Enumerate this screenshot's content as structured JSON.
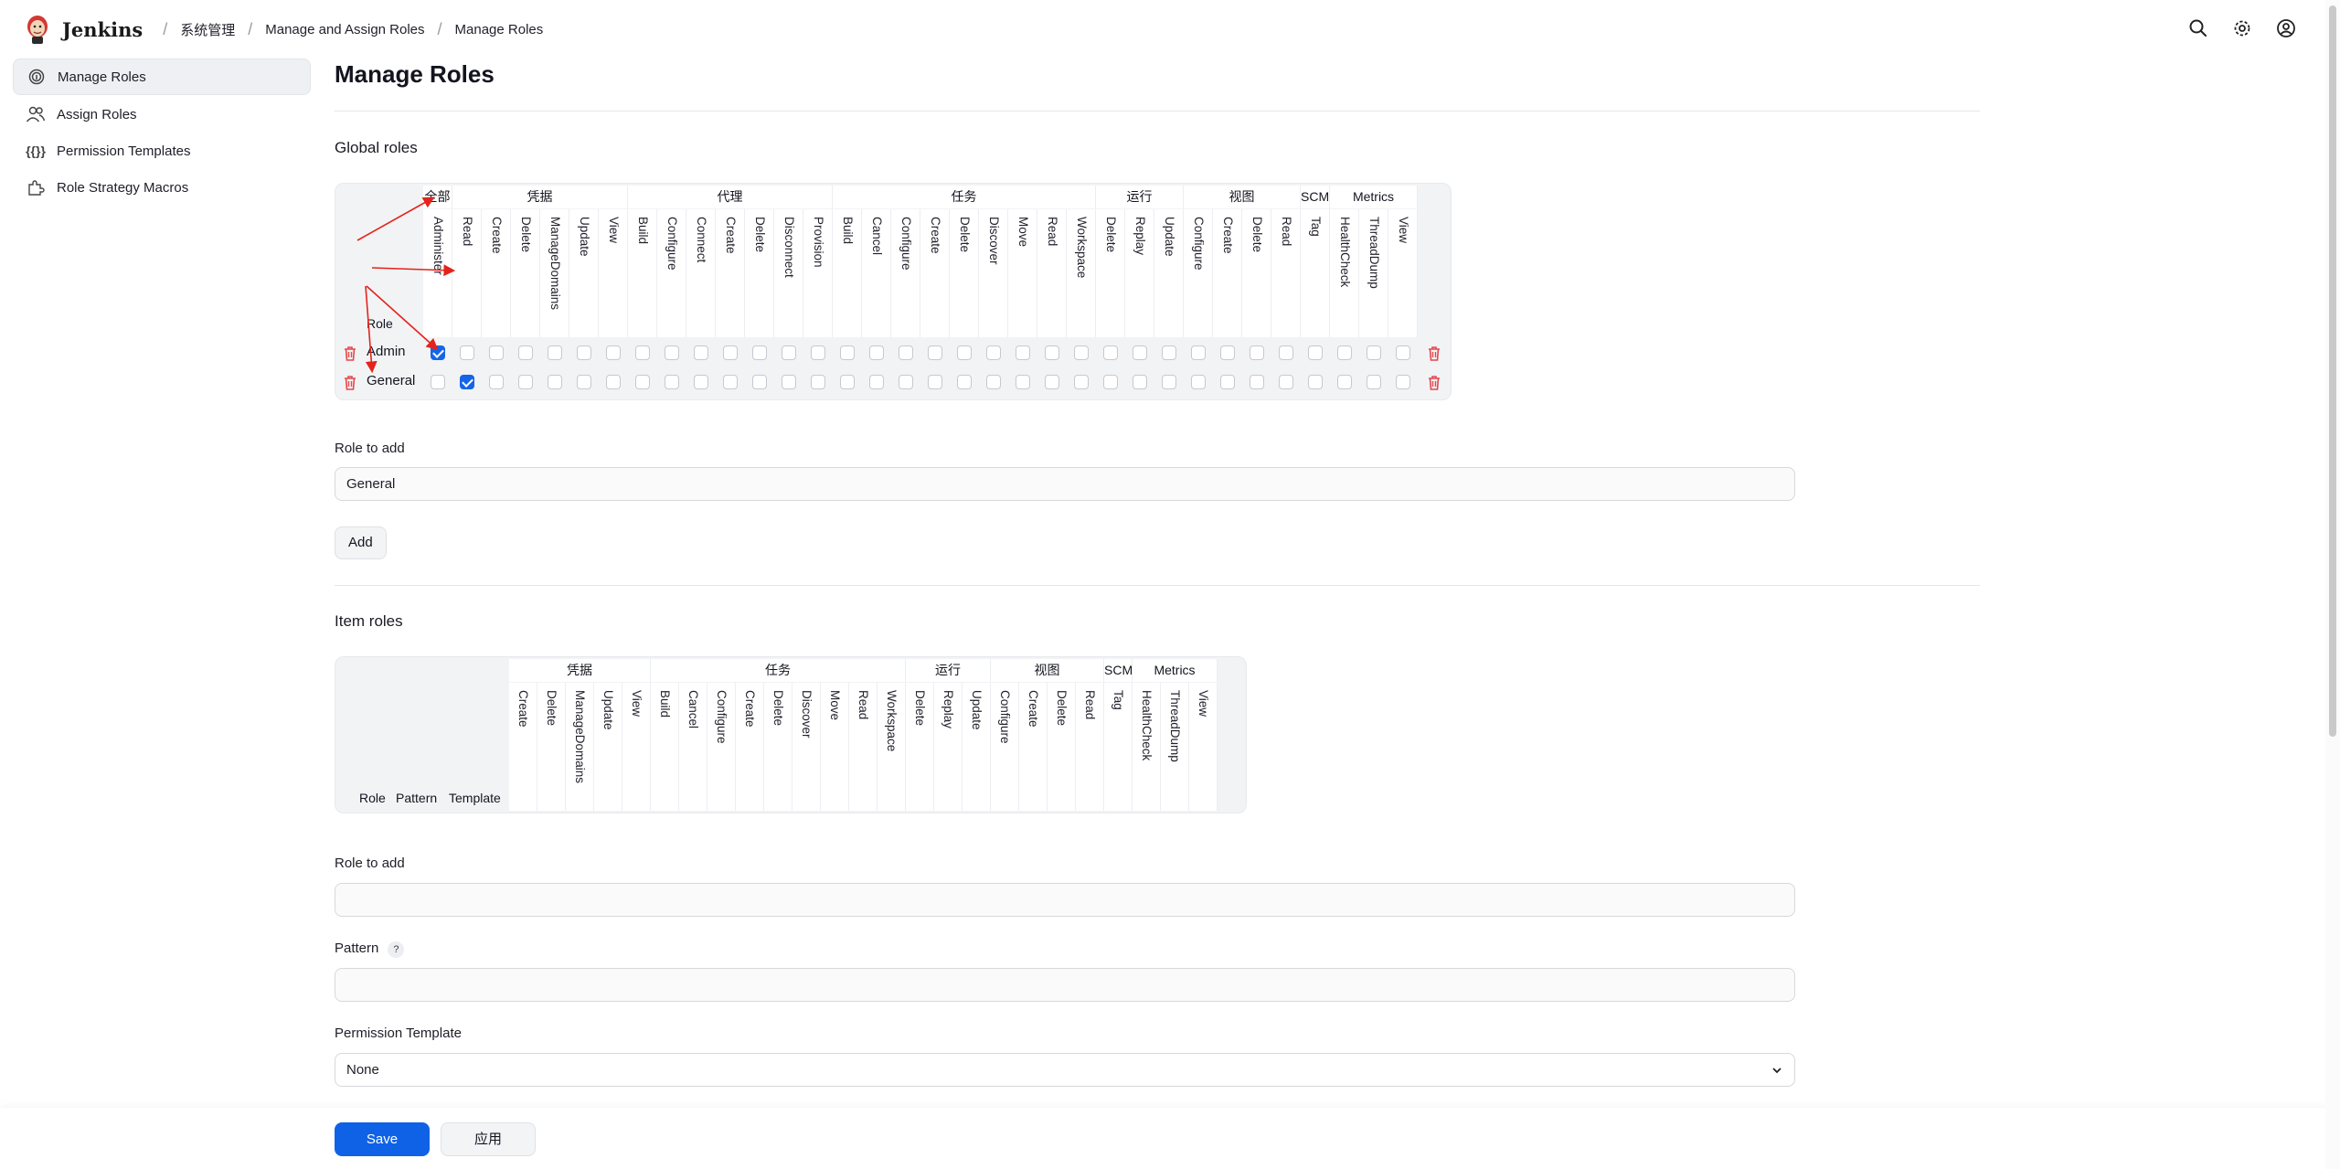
{
  "header": {
    "brand": "Jenkins",
    "breadcrumbs": [
      "系统管理",
      "Manage and Assign Roles",
      "Manage Roles"
    ]
  },
  "sidebar": {
    "items": [
      {
        "label": "Manage Roles",
        "icon": "fingerprint-icon",
        "active": true
      },
      {
        "label": "Assign Roles",
        "icon": "users-icon",
        "active": false
      },
      {
        "label": "Permission Templates",
        "icon": "braces-icon",
        "active": false
      },
      {
        "label": "Role Strategy Macros",
        "icon": "puzzle-icon",
        "active": false
      }
    ]
  },
  "page": {
    "title": "Manage Roles"
  },
  "global_roles": {
    "title": "Global roles",
    "role_header": "Role",
    "groups": [
      {
        "name": "全部",
        "perms": [
          "Administer"
        ]
      },
      {
        "name": "凭据",
        "perms": [
          "Read",
          "Create",
          "Delete",
          "ManageDomains",
          "Update",
          "View"
        ]
      },
      {
        "name": "代理",
        "perms": [
          "Build",
          "Configure",
          "Connect",
          "Create",
          "Delete",
          "Disconnect",
          "Provision"
        ]
      },
      {
        "name": "任务",
        "perms": [
          "Build",
          "Cancel",
          "Configure",
          "Create",
          "Delete",
          "Discover",
          "Move",
          "Read",
          "Workspace"
        ]
      },
      {
        "name": "运行",
        "perms": [
          "Delete",
          "Replay",
          "Update"
        ]
      },
      {
        "name": "视图",
        "perms": [
          "Configure",
          "Create",
          "Delete",
          "Read"
        ]
      },
      {
        "name": "SCM",
        "perms": [
          "Tag"
        ]
      },
      {
        "name": "Metrics",
        "perms": [
          "HealthCheck",
          "ThreadDump",
          "View"
        ]
      }
    ],
    "rows": [
      {
        "name": "Admin",
        "checked": [
          0
        ]
      },
      {
        "name": "General",
        "checked": [
          1
        ]
      }
    ],
    "role_to_add_label": "Role to add",
    "role_to_add_value": "General",
    "add_button": "Add"
  },
  "item_roles": {
    "title": "Item roles",
    "headers": [
      "Role",
      "Pattern",
      "Template"
    ],
    "groups": [
      {
        "name": "凭据",
        "perms": [
          "Create",
          "Delete",
          "ManageDomains",
          "Update",
          "View"
        ]
      },
      {
        "name": "任务",
        "perms": [
          "Build",
          "Cancel",
          "Configure",
          "Create",
          "Delete",
          "Discover",
          "Move",
          "Read",
          "Workspace"
        ]
      },
      {
        "name": "运行",
        "perms": [
          "Delete",
          "Replay",
          "Update"
        ]
      },
      {
        "name": "视图",
        "perms": [
          "Configure",
          "Create",
          "Delete",
          "Read"
        ]
      },
      {
        "name": "SCM",
        "perms": [
          "Tag"
        ]
      },
      {
        "name": "Metrics",
        "perms": [
          "HealthCheck",
          "ThreadDump",
          "View"
        ]
      }
    ],
    "role_to_add_label": "Role to add",
    "role_to_add_value": "",
    "pattern_label": "Pattern",
    "pattern_help": "?",
    "pattern_value": "",
    "template_label": "Permission Template",
    "template_value": "None"
  },
  "footer": {
    "save": "Save",
    "apply": "应用"
  },
  "colors": {
    "primary": "#0f62e6",
    "danger": "#e5484d",
    "annotation": "#e3241c"
  }
}
